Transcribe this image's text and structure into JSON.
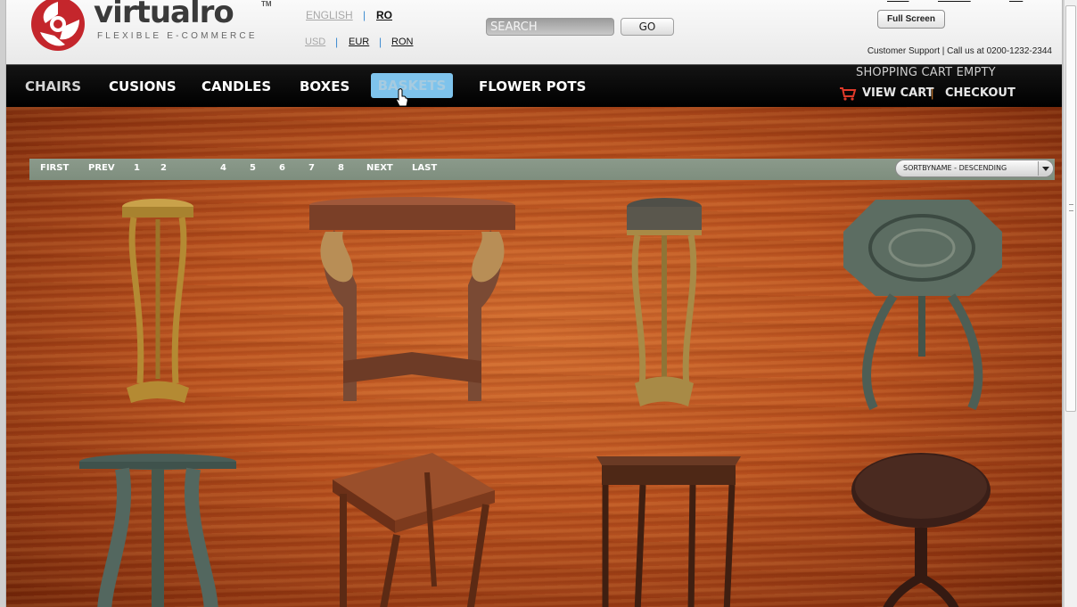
{
  "brand": {
    "name": "virtualro",
    "trademark": "TM",
    "tagline": "FLEXIBLE E-COMMERCE"
  },
  "header": {
    "languages": [
      {
        "label": "ENGLISH",
        "active": false
      },
      {
        "label": "RO",
        "active": true
      }
    ],
    "currencies": [
      {
        "label": "USD",
        "active": false
      },
      {
        "label": "EUR",
        "active": true
      },
      {
        "label": "RON",
        "active": true
      }
    ],
    "separator": "|",
    "search": {
      "placeholder": "SEARCH",
      "button": "GO"
    },
    "full_screen": "Full Screen",
    "support": "Customer Support | Call us at 0200-1232-2344"
  },
  "nav": {
    "items": [
      {
        "label": "CHAIRS"
      },
      {
        "label": "CUSIONS"
      },
      {
        "label": "CANDLES"
      },
      {
        "label": "BOXES"
      },
      {
        "label": "BASKETS",
        "hovered": true
      },
      {
        "label": "FLOWER POTS"
      }
    ],
    "cart_status": "SHOPPING CART EMPTY",
    "view_cart": "VIEW CART",
    "checkout": "CHECKOUT"
  },
  "pager": {
    "first": "FIRST",
    "prev": "PREV",
    "pages": [
      "1",
      "2",
      "4",
      "5",
      "6",
      "7",
      "8"
    ],
    "next": "NEXT",
    "last": "LAST",
    "sort": "SORTBYNAME - DESCENDING"
  },
  "colors": {
    "accent": "#7ec3ec",
    "wood": "#b9501e",
    "pager": "#849484"
  },
  "icons": {
    "logo": "virtualro-logo-icon",
    "cart": "shopping-cart-icon",
    "cursor": "hand-pointer-icon",
    "dropdown": "chevron-down-icon"
  }
}
